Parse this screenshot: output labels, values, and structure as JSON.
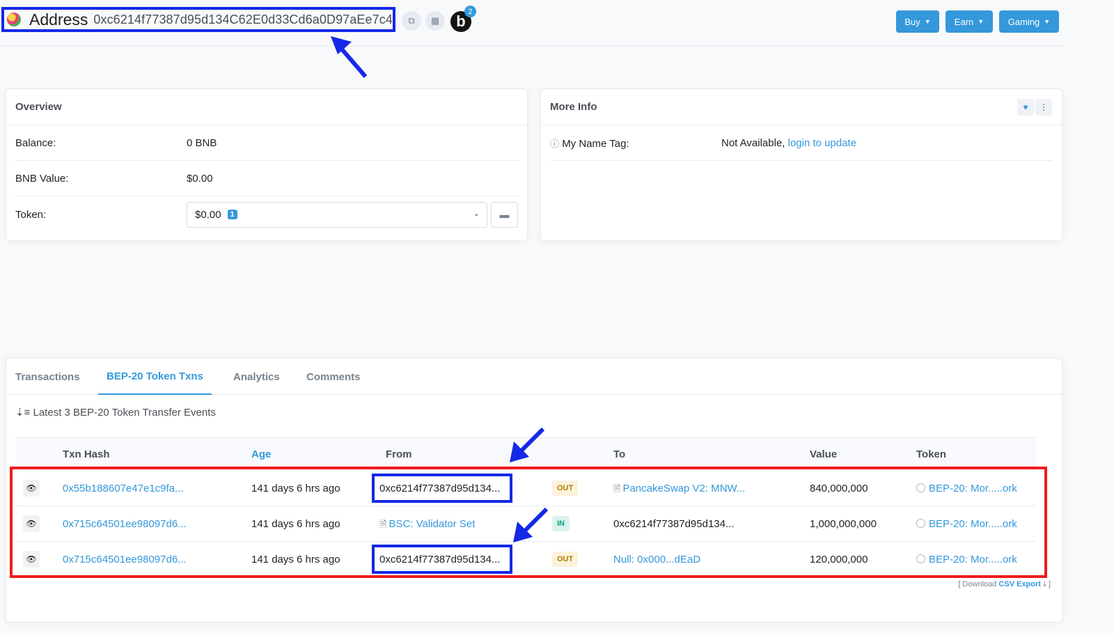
{
  "header": {
    "address_label": "Address",
    "address_hash": "0xc6214f77387d95d134C62E0d33Cd6a0D97aEe7c4",
    "badge_count": "2",
    "b_logo": "b",
    "buttons": [
      {
        "label": "Buy"
      },
      {
        "label": "Earn"
      },
      {
        "label": "Gaming"
      }
    ]
  },
  "overview": {
    "title": "Overview",
    "balance_label": "Balance:",
    "balance_value": "0 BNB",
    "bnb_value_label": "BNB Value:",
    "bnb_value": "$0.00",
    "token_label": "Token:",
    "token_value": "$0.00",
    "token_count": "1"
  },
  "more_info": {
    "title": "More Info",
    "name_tag_label": "My Name Tag:",
    "name_tag_value": "Not Available,",
    "login_link": "login to update"
  },
  "tabs": [
    {
      "label": "Transactions"
    },
    {
      "label": "BEP-20 Token Txns",
      "active": true
    },
    {
      "label": "Analytics"
    },
    {
      "label": "Comments"
    }
  ],
  "table": {
    "subtitle": "Latest 3 BEP-20 Token Transfer Events",
    "columns": {
      "hash": "Txn Hash",
      "age": "Age",
      "from": "From",
      "to": "To",
      "value": "Value",
      "token": "Token"
    },
    "rows": [
      {
        "hash": "0x55b188607e47e1c9fa...",
        "age": "141 days 6 hrs ago",
        "from": "0xc6214f77387d95d134...",
        "direction": "OUT",
        "to": "PancakeSwap V2: MNW...",
        "value": "840,000,000",
        "token": "BEP-20: Mor.....ork"
      },
      {
        "hash": "0x715c64501ee98097d6...",
        "age": "141 days 6 hrs ago",
        "from": "BSC: Validator Set",
        "direction": "IN",
        "to": "0xc6214f77387d95d134...",
        "value": "1,000,000,000",
        "token": "BEP-20: Mor.....ork"
      },
      {
        "hash": "0x715c64501ee98097d6...",
        "age": "141 days 6 hrs ago",
        "from": "0xc6214f77387d95d134...",
        "direction": "OUT",
        "to": "Null: 0x000...dEaD",
        "value": "120,000,000",
        "token": "BEP-20: Mor.....ork"
      }
    ],
    "csv_prefix": "[ Download",
    "csv_link": "CSV Export",
    "csv_suffix": "]"
  },
  "colors": {
    "accent": "#3498db",
    "highlight_blue": "#1428e6",
    "highlight_red": "#ee1c1c"
  }
}
